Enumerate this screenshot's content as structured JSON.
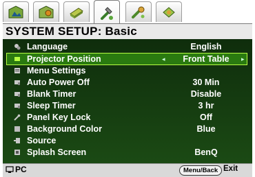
{
  "tabs": [
    {
      "icon": "picture-icon",
      "active": false
    },
    {
      "icon": "picture-advanced-icon",
      "active": false
    },
    {
      "icon": "display-icon",
      "active": false
    },
    {
      "icon": "system-setup-icon",
      "active": true
    },
    {
      "icon": "system-advanced-icon",
      "active": false
    },
    {
      "icon": "information-icon",
      "active": false
    }
  ],
  "title": "SYSTEM SETUP: Basic",
  "menu": [
    {
      "label": "Language",
      "value": "English",
      "icon": "language-icon"
    },
    {
      "label": "Projector Position",
      "value": "Front Table",
      "icon": "projector-position-icon",
      "selected": true
    },
    {
      "label": "Menu Settings",
      "value": "",
      "icon": "menu-settings-icon"
    },
    {
      "label": "Auto Power Off",
      "value": "30 Min",
      "icon": "auto-power-off-icon"
    },
    {
      "label": "Blank Timer",
      "value": "Disable",
      "icon": "blank-timer-icon"
    },
    {
      "label": "Sleep Timer",
      "value": "3 hr",
      "icon": "sleep-timer-icon"
    },
    {
      "label": "Panel Key Lock",
      "value": "Off",
      "icon": "panel-key-lock-icon"
    },
    {
      "label": "Background Color",
      "value": "Blue",
      "icon": "background-color-icon"
    },
    {
      "label": "Source",
      "value": "",
      "icon": "source-icon"
    },
    {
      "label": "Splash Screen",
      "value": "BenQ",
      "icon": "splash-screen-icon"
    }
  ],
  "footer": {
    "source": "PC",
    "key_label": "Menu/Back",
    "exit_label": "Exit"
  },
  "colors": {
    "panel_bg": "#103c0a",
    "highlight": "#2a7a10",
    "highlight_border": "#b7ff42"
  }
}
